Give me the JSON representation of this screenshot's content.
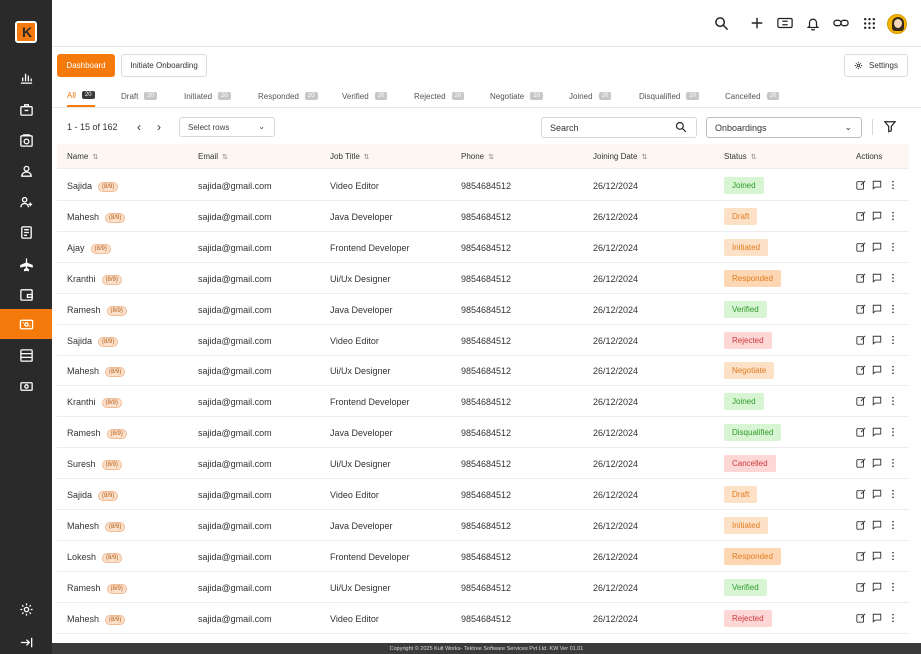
{
  "brand": {
    "logo_letter": "K",
    "accent": "#f47a0c"
  },
  "sidebar": {
    "items": [
      {
        "icon": "bar-chart-icon"
      },
      {
        "icon": "briefcase-icon"
      },
      {
        "icon": "camera-icon"
      },
      {
        "icon": "user-badge-icon"
      },
      {
        "icon": "users-icon"
      },
      {
        "icon": "document-icon"
      },
      {
        "icon": "airplane-icon"
      },
      {
        "icon": "wallet-icon"
      },
      {
        "icon": "ticket-icon",
        "active": true
      },
      {
        "icon": "table-icon"
      },
      {
        "icon": "money-icon"
      }
    ],
    "bottom": [
      {
        "icon": "gear-icon"
      },
      {
        "icon": "logout-icon"
      }
    ]
  },
  "header": {
    "icons": [
      "search-icon",
      "plus-icon",
      "ticket-icon",
      "bell-icon",
      "link-icon",
      "apps-grid-icon",
      "avatar"
    ]
  },
  "toolbar": {
    "dashboard_label": "Dashboard",
    "initiate_label": "Initiate Onboarding",
    "settings_label": "Settings"
  },
  "status_tabs": [
    {
      "label": "All",
      "count": "20",
      "active": true
    },
    {
      "label": "Draft",
      "count": "20"
    },
    {
      "label": "Initiated",
      "count": "20"
    },
    {
      "label": "Responded",
      "count": "20"
    },
    {
      "label": "Verified",
      "count": "20"
    },
    {
      "label": "Rejected",
      "count": "20"
    },
    {
      "label": "Negotiate",
      "count": "20"
    },
    {
      "label": "Joined",
      "count": "20"
    },
    {
      "label": "Disqualified",
      "count": "20"
    },
    {
      "label": "Cancelled",
      "count": "20"
    }
  ],
  "filters": {
    "pagination": "1 - 15  of 162",
    "select_rows_placeholder": "Select rows",
    "search_placeholder": "Search",
    "onboardings_value": "Onboardings"
  },
  "table": {
    "columns": [
      "Name",
      "Email",
      "Job Title",
      "Phone",
      "Joining Date",
      "Status",
      "Actions"
    ],
    "rows": [
      {
        "name": "Sajida",
        "badge": "(8/9)",
        "email": "sajida@gmail.com",
        "job": "Video Editor",
        "phone": "9854684512",
        "date": "26/12/2024",
        "status": "Joined"
      },
      {
        "name": "Mahesh",
        "badge": "(8/9)",
        "email": "sajida@gmail.com",
        "job": "Java Developer",
        "phone": "9854684512",
        "date": "26/12/2024",
        "status": "Draft"
      },
      {
        "name": "Ajay",
        "badge": "(8/9)",
        "email": "sajida@gmail.com",
        "job": "Frontend Developer",
        "phone": "9854684512",
        "date": "26/12/2024",
        "status": "Initiated"
      },
      {
        "name": "Kranthi",
        "badge": "(8/9)",
        "email": "sajida@gmail.com",
        "job": "Ui/Ux Designer",
        "phone": "9854684512",
        "date": "26/12/2024",
        "status": "Responded"
      },
      {
        "name": "Ramesh",
        "badge": "(8/9)",
        "email": "sajida@gmail.com",
        "job": "Java Developer",
        "phone": "9854684512",
        "date": "26/12/2024",
        "status": "Verified"
      },
      {
        "name": "Sajida",
        "badge": "(8/9)",
        "email": "sajida@gmail.com",
        "job": "Video Editor",
        "phone": "9854684512",
        "date": "26/12/2024",
        "status": "Rejected"
      },
      {
        "name": "Mahesh",
        "badge": "(8/9)",
        "email": "sajida@gmail.com",
        "job": "Ui/Ux Designer",
        "phone": "9854684512",
        "date": "26/12/2024",
        "status": "Negotiate"
      },
      {
        "name": "Kranthi",
        "badge": "(8/9)",
        "email": "sajida@gmail.com",
        "job": "Frontend Developer",
        "phone": "9854684512",
        "date": "26/12/2024",
        "status": "Joined"
      },
      {
        "name": "Ramesh",
        "badge": "(8/9)",
        "email": "sajida@gmail.com",
        "job": "Java Developer",
        "phone": "9854684512",
        "date": "26/12/2024",
        "status": "Disqualified"
      },
      {
        "name": "Suresh",
        "badge": "(8/9)",
        "email": "sajida@gmail.com",
        "job": "Ui/Ux Designer",
        "phone": "9854684512",
        "date": "26/12/2024",
        "status": "Cancelled"
      },
      {
        "name": "Sajida",
        "badge": "(8/9)",
        "email": "sajida@gmail.com",
        "job": "Video Editor",
        "phone": "9854684512",
        "date": "26/12/2024",
        "status": "Draft"
      },
      {
        "name": "Mahesh",
        "badge": "(8/9)",
        "email": "sajida@gmail.com",
        "job": "Java Developer",
        "phone": "9854684512",
        "date": "26/12/2024",
        "status": "Initiated"
      },
      {
        "name": "Lokesh",
        "badge": "(8/9)",
        "email": "sajida@gmail.com",
        "job": "Frontend Developer",
        "phone": "9854684512",
        "date": "26/12/2024",
        "status": "Responded"
      },
      {
        "name": "Ramesh",
        "badge": "(8/9)",
        "email": "sajida@gmail.com",
        "job": "Ui/Ux Designer",
        "phone": "9854684512",
        "date": "26/12/2024",
        "status": "Verified"
      },
      {
        "name": "Mahesh",
        "badge": "(8/9)",
        "email": "sajida@gmail.com",
        "job": "Video Editor",
        "phone": "9854684512",
        "date": "26/12/2024",
        "status": "Rejected"
      }
    ]
  },
  "status_colors": {
    "Joined": {
      "bg": "#d8f5d3",
      "fg": "#2f9a2a"
    },
    "Draft": {
      "bg": "#fde1c6",
      "fg": "#e07b1f"
    },
    "Initiated": {
      "bg": "#fde1c6",
      "fg": "#e07b1f"
    },
    "Responded": {
      "bg": "#fdd7b3",
      "fg": "#e07b1f"
    },
    "Verified": {
      "bg": "#d8f5d3",
      "fg": "#2f9a2a"
    },
    "Rejected": {
      "bg": "#fdd6d6",
      "fg": "#d13a3a"
    },
    "Negotiate": {
      "bg": "#fde1c6",
      "fg": "#e07b1f"
    },
    "Disqualified": {
      "bg": "#d8f5d3",
      "fg": "#2f9a2a"
    },
    "Cancelled": {
      "bg": "#fdd6d6",
      "fg": "#d13a3a"
    }
  },
  "footer": {
    "text": "Copyright © 2025 Kult Works- Tektree Software Services Pvt Ltd.  KW Ver 01.01"
  }
}
